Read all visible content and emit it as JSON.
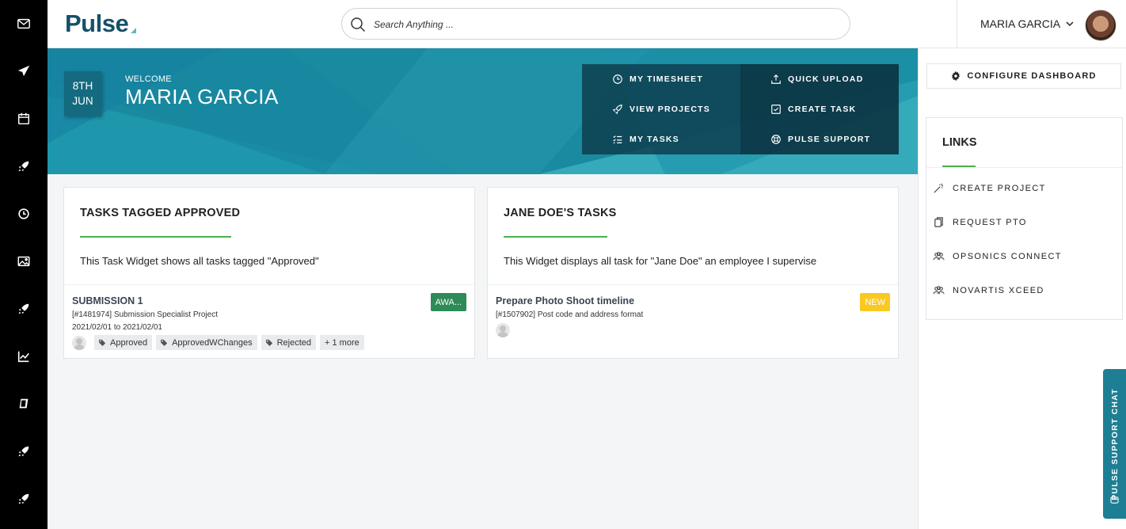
{
  "app": {
    "logo_text": "Pulse"
  },
  "rail": {
    "icons": [
      "mail-icon",
      "send-icon",
      "calendar-icon",
      "rocket-icon",
      "clock-icon",
      "image-icon",
      "rocket-icon",
      "chart-icon",
      "book-icon",
      "rocket-icon",
      "rocket-icon"
    ]
  },
  "search": {
    "placeholder": "Search Anything ..."
  },
  "user": {
    "name": "MARIA GARCIA"
  },
  "hero": {
    "date_day": "8TH",
    "date_month": "JUN",
    "welcome": "WELCOME",
    "name": "MARIA GARCIA",
    "quick_links": [
      {
        "label": "MY TIMESHEET",
        "icon": "clock-icon"
      },
      {
        "label": "QUICK UPLOAD",
        "icon": "upload-icon"
      },
      {
        "label": "VIEW PROJECTS",
        "icon": "rocket-icon"
      },
      {
        "label": "CREATE TASK",
        "icon": "checkbox-icon"
      },
      {
        "label": "MY TASKS",
        "icon": "list-icon"
      },
      {
        "label": "PULSE SUPPORT",
        "icon": "lifebuoy-icon"
      }
    ]
  },
  "widgets": [
    {
      "title": "TASKS TAGGED APPROVED",
      "description": "This Task Widget shows all tasks tagged \"Approved\"",
      "task": {
        "title": "SUBMISSION 1",
        "ref": "[#1481974] Submission Specialist Project",
        "dates": "2021/02/01 to 2021/02/01",
        "status": "AWA...",
        "tags": [
          "Approved",
          "ApprovedWChanges",
          "Rejected"
        ],
        "more": "+ 1 more"
      }
    },
    {
      "title": "JANE DOE'S TASKS",
      "description": "This Widget displays all task for \"Jane Doe\" an employee I supervise",
      "task": {
        "title": "Prepare Photo Shoot timeline",
        "ref": "[#1507902] Post code and address format",
        "status": "NEW"
      }
    }
  ],
  "right_panel": {
    "configure_label": "CONFIGURE DASHBOARD",
    "links_title": "LINKS",
    "links": [
      {
        "label": "CREATE PROJECT",
        "icon": "magic-wand-icon"
      },
      {
        "label": "REQUEST PTO",
        "icon": "copy-icon"
      },
      {
        "label": "OPSONICS CONNECT",
        "icon": "users-icon"
      },
      {
        "label": "NOVARTIS XCEED",
        "icon": "users-icon"
      }
    ]
  },
  "chat": {
    "label": "PULSE SUPPORT CHAT"
  },
  "colors": {
    "brand": "#15506b",
    "hero": "#1a8aa0",
    "accent_green": "#4caf50",
    "badge_green": "#2e8b57",
    "badge_yellow": "#f9c823"
  }
}
